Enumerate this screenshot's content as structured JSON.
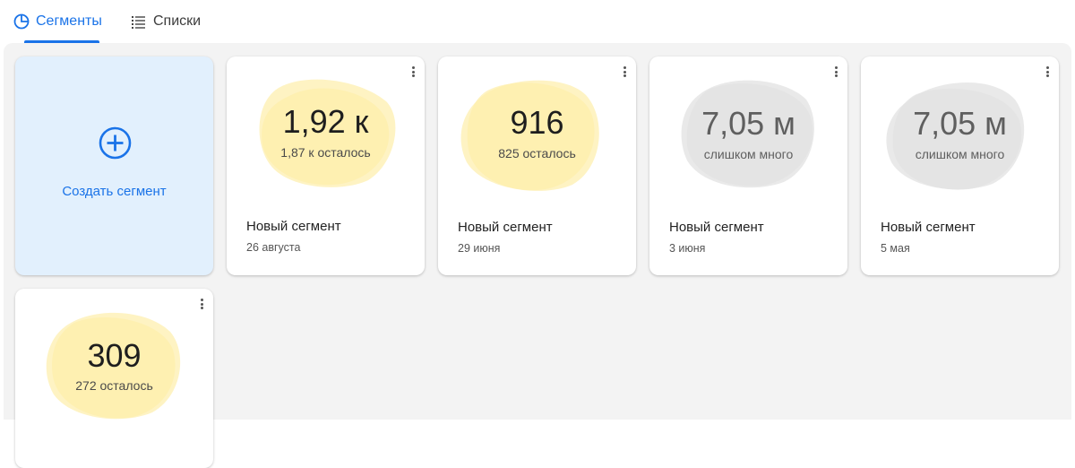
{
  "tabs": [
    {
      "label": "Сегменты",
      "icon": "pie-chart-icon",
      "active": true
    },
    {
      "label": "Списки",
      "icon": "list-icon",
      "active": false
    }
  ],
  "create": {
    "label": "Создать сегмент",
    "icon": "plus-circle-icon"
  },
  "colors": {
    "accent": "#1a73e8",
    "createBg": "#e2f0fd",
    "blobYellow": "#fdeeaa",
    "blobGray": "#e2e2e2",
    "panelBg": "#f3f3f3"
  },
  "segments": [
    {
      "value": "1,92 к",
      "remaining": "1,87 к осталось",
      "name": "Новый сегмент",
      "date": "26 августа",
      "status": "ok"
    },
    {
      "value": "916",
      "remaining": "825 осталось",
      "name": "Новый сегмент",
      "date": "29 июня",
      "status": "ok"
    },
    {
      "value": "7,05 м",
      "remaining": "слишком много",
      "name": "Новый сегмент",
      "date": "3 июня",
      "status": "too-many"
    },
    {
      "value": "7,05 м",
      "remaining": "слишком много",
      "name": "Новый сегмент",
      "date": "5 мая",
      "status": "too-many"
    },
    {
      "value": "309",
      "remaining": "272 осталось",
      "name": "",
      "date": "",
      "status": "ok"
    }
  ]
}
